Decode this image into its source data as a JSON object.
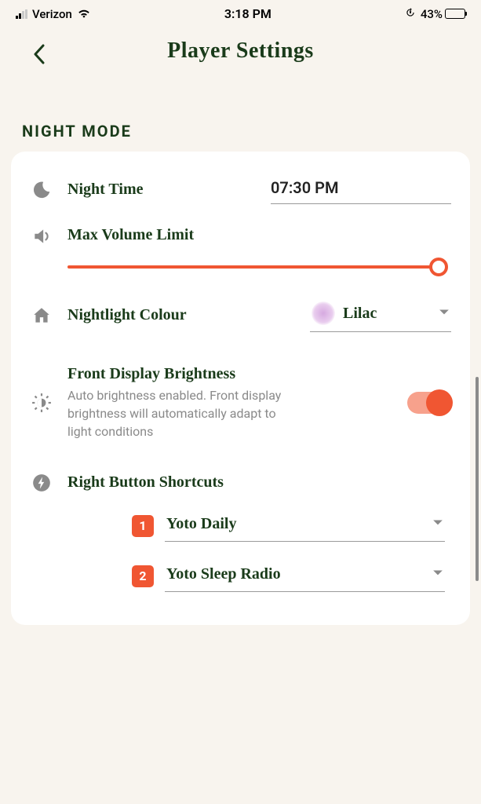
{
  "status": {
    "carrier": "Verizon",
    "time": "3:18 PM",
    "battery_pct": "43%",
    "battery_fill": 43
  },
  "header": {
    "title": "Player Settings"
  },
  "section": {
    "label": "NIGHT MODE"
  },
  "night_time": {
    "label": "Night Time",
    "value": "07:30 PM"
  },
  "volume": {
    "label": "Max Volume Limit",
    "percent": 98
  },
  "nightlight": {
    "label": "Nightlight Colour",
    "value": "Lilac",
    "swatch_hex": "#d6a9e0"
  },
  "brightness": {
    "label": "Front Display Brightness",
    "description": "Auto brightness enabled. Front display brightness will automatically adapt to light conditions",
    "enabled": true
  },
  "shortcuts": {
    "label": "Right Button Shortcuts",
    "items": [
      {
        "num": "1",
        "value": "Yoto Daily"
      },
      {
        "num": "2",
        "value": "Yoto Sleep Radio"
      }
    ]
  },
  "accent": "#f05632"
}
